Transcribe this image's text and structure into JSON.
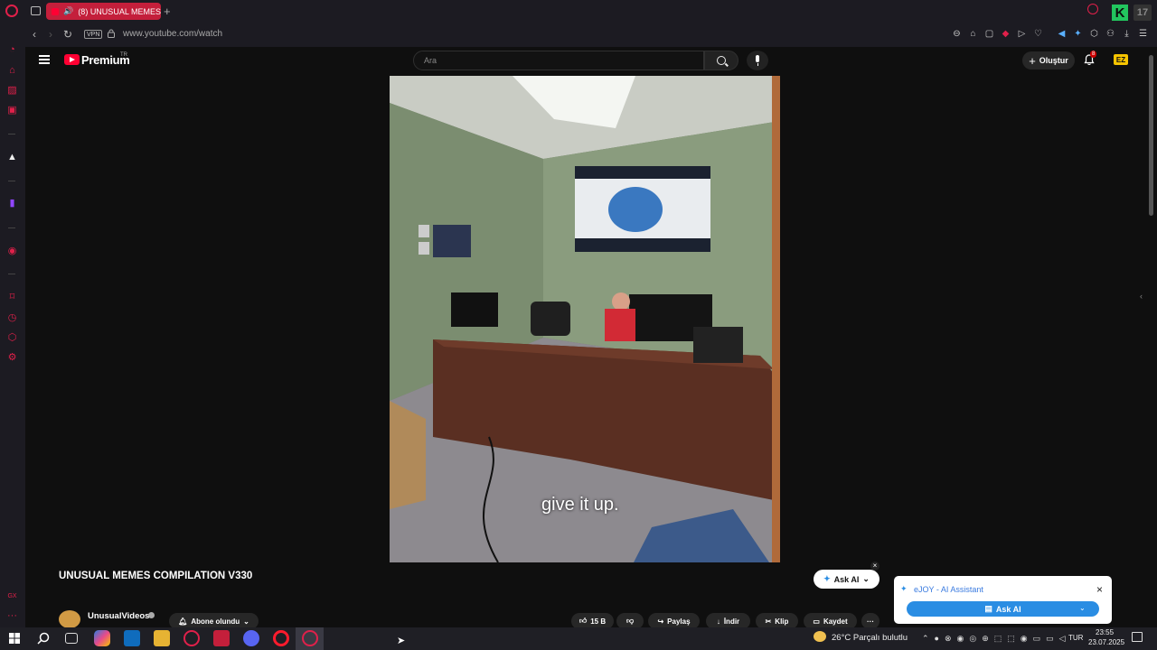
{
  "browser": {
    "tab_title": "(8) UNUSUAL MEMES",
    "url": "www.youtube.com/watch",
    "vpn_label": "VPN",
    "new_tab": "+",
    "extension_badge": "17"
  },
  "youtube": {
    "logo_text": "Premium",
    "region": "TR",
    "search_placeholder": "Ara",
    "create_label": "Oluştur",
    "notification_count": "8",
    "avatar_text": "EZ"
  },
  "video": {
    "caption": "give it up.",
    "title": "UNUSUAL MEMES COMPILATION V330",
    "channel_name": "UnusualVideos",
    "subscribe_label": "Abone olundu",
    "likes": "15 B",
    "share_label": "Paylaş",
    "download_label": "İndir",
    "clip_label": "Klip",
    "save_label": "Kaydet",
    "more_label": "···"
  },
  "ask_ai": {
    "pill_label": "Ask AI",
    "panel_title": "eJOY - AI Assistant",
    "panel_button": "Ask AI"
  },
  "taskbar": {
    "weather": "26°C  Parçalı bulutlu",
    "language": "TUR",
    "time": "23:55",
    "date": "23.07.2025"
  },
  "colors": {
    "opera_red": "#e0204a",
    "youtube_red": "#ff0033",
    "ejoy_blue": "#2a8de3",
    "background": "#0f0f0f"
  }
}
